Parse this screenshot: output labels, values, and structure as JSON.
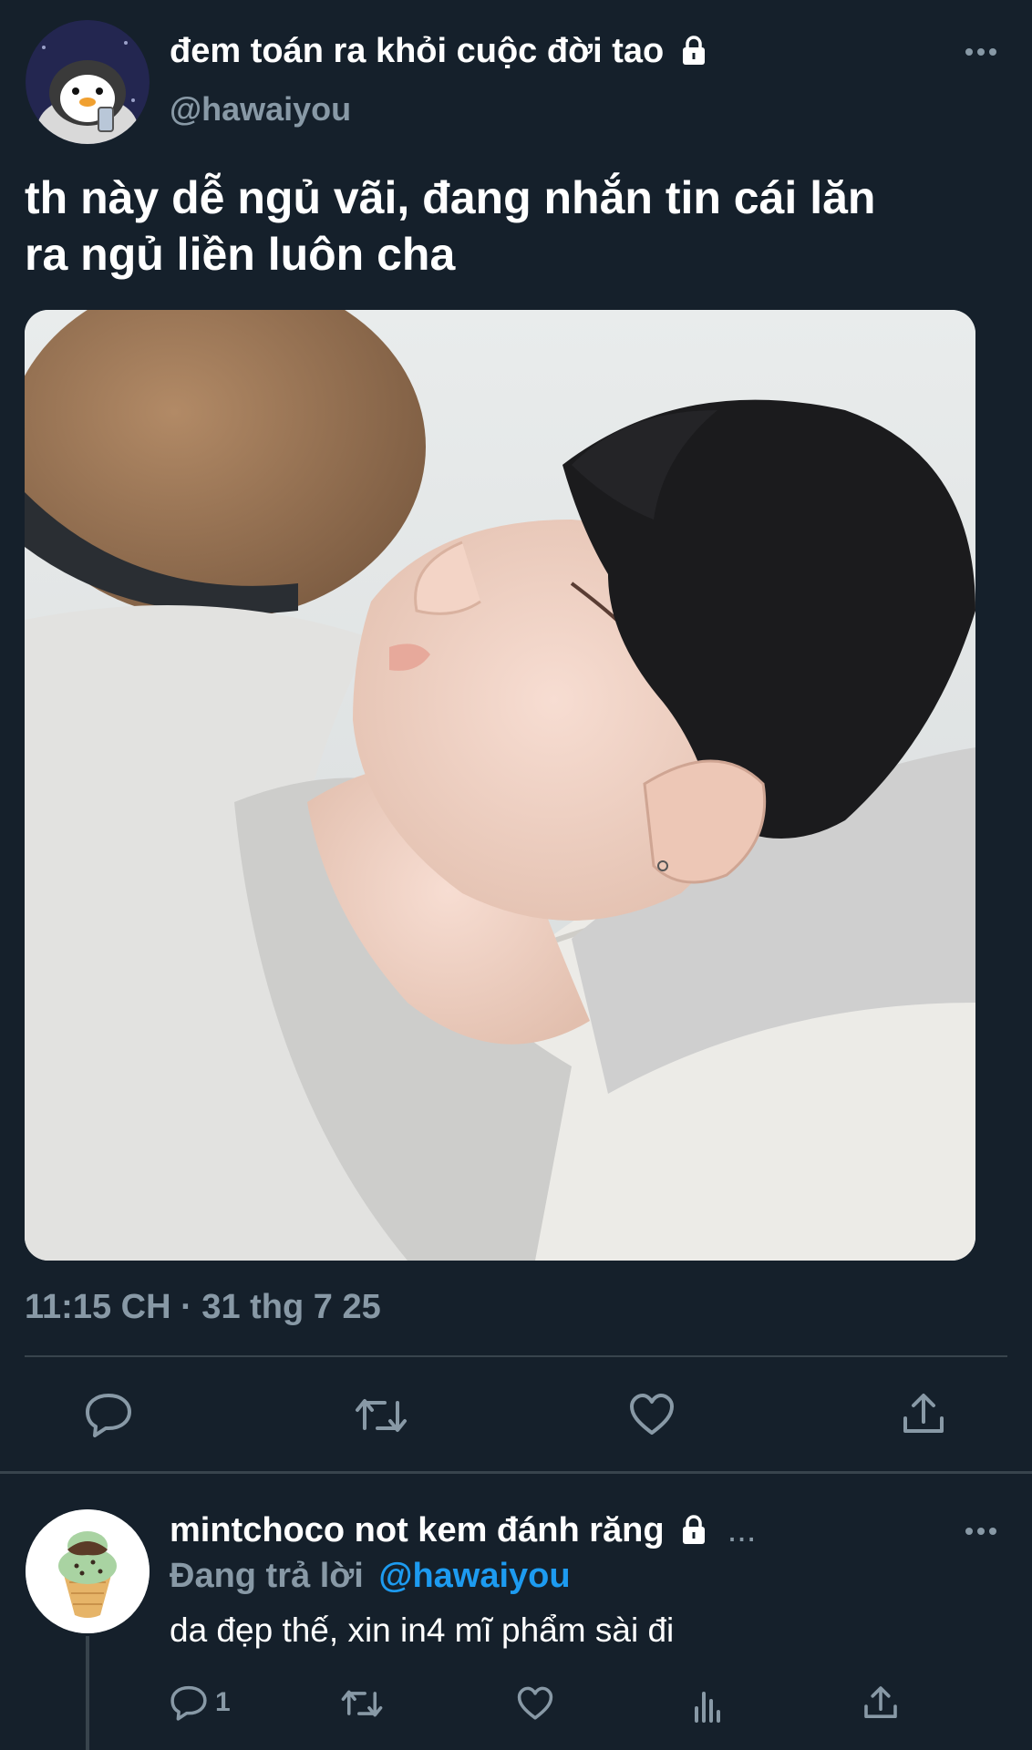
{
  "tweet": {
    "display_name": "đem toán ra khỏi cuộc đời tao",
    "handle": "@hawaiyou",
    "text_line1": "th này dễ ngủ vãi, đang nhắn tin cái lăn",
    "text_line2": "ra ngủ liền luôn cha",
    "timestamp": "11:15 CH · 31 thg 7 25",
    "locked_icon": "lock-icon",
    "more_icon": "more-icon"
  },
  "actions": [
    {
      "icon": "reply-icon"
    },
    {
      "icon": "retweet-icon"
    },
    {
      "icon": "like-icon"
    },
    {
      "icon": "share-icon"
    }
  ],
  "reply": {
    "display_name": "mintchoco not kem đánh răng",
    "ellipsis": "...",
    "replying_label": "Đang trả lời",
    "replying_handle": "@hawaiyou",
    "text": "da đẹp thế, xin in4 mĩ phẩm sài đi",
    "reply_count": "1"
  },
  "colors": {
    "background": "#15202b",
    "muted": "#8899a6",
    "link": "#1d9bf0",
    "divider": "#38444d"
  }
}
